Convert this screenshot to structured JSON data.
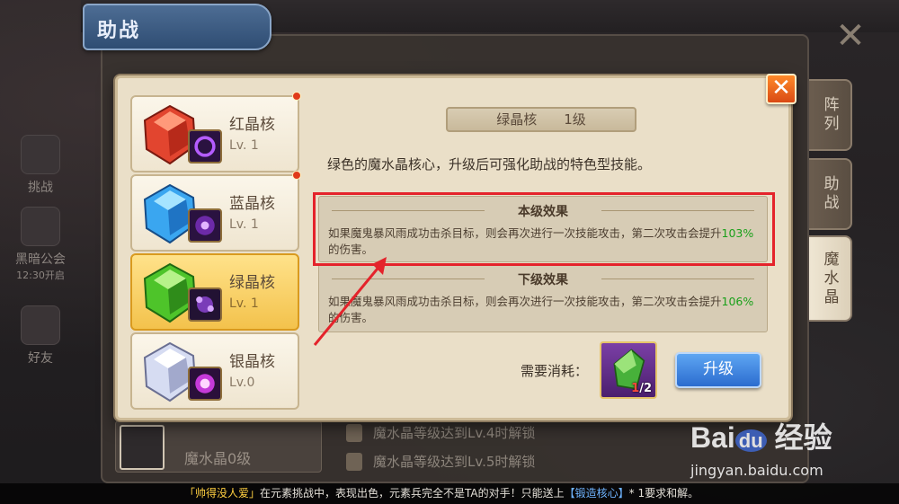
{
  "background": {
    "window_title": "助战",
    "left_menu": [
      "挑战",
      "黑暗公会",
      "好友"
    ],
    "left_menu_sub": "12:30开启",
    "side_tabs": [
      {
        "label": "阵列",
        "active": false
      },
      {
        "label": "助战",
        "active": false
      },
      {
        "label": "魔水晶",
        "active": true
      }
    ],
    "lock_rows": [
      "魔水晶等级达到Lv.4时解锁",
      "魔水晶等级达到Lv.5时解锁"
    ],
    "avatar_level_text": "魔水晶0级"
  },
  "core_list": [
    {
      "name": "红晶核",
      "level": "Lv. 1",
      "color": "red",
      "selected": false
    },
    {
      "name": "蓝晶核",
      "level": "Lv. 1",
      "color": "blue",
      "selected": false
    },
    {
      "name": "绿晶核",
      "level": "Lv. 1",
      "color": "green",
      "selected": true
    },
    {
      "name": "银晶核",
      "level": "Lv.0",
      "color": "silver",
      "selected": false
    }
  ],
  "detail": {
    "title": "绿晶核",
    "level": "1级",
    "description": "绿色的魔水晶核心，升级后可强化助战的特色型技能。",
    "current_effect": {
      "heading": "本级效果",
      "text_before": "如果魔鬼暴风雨成功击杀目标，则会再次进行一次技能攻击，第二次攻击会提升",
      "pct": "103%",
      "text_after": "的伤害。"
    },
    "next_effect": {
      "heading": "下级效果",
      "text_before": "如果魔鬼暴风雨成功击杀目标，则会再次进行一次技能攻击，第二次攻击会提升",
      "pct": "106%",
      "text_after": "的伤害。"
    },
    "cost_label": "需要消耗：",
    "cost_have": "1",
    "cost_need": "/2",
    "upgrade_label": "升级"
  },
  "ticker": {
    "name": "「帅得没人爱」",
    "text1": "在元素挑战中，表现出色，元素兵完全不是TA的对手！只能送上",
    "item": "【锻造核心】",
    "text2": "* 1要求和解。"
  },
  "watermark": {
    "brand": "Bai",
    "brand_du": "du",
    "brand_cn": "经验",
    "url": "jingyan.baidu.com"
  },
  "colors": {
    "accent_green": "#1aa01a",
    "highlight_red": "#e4232b",
    "button_blue": "#2b6ccf",
    "selected_gold": "#f3c24c"
  }
}
